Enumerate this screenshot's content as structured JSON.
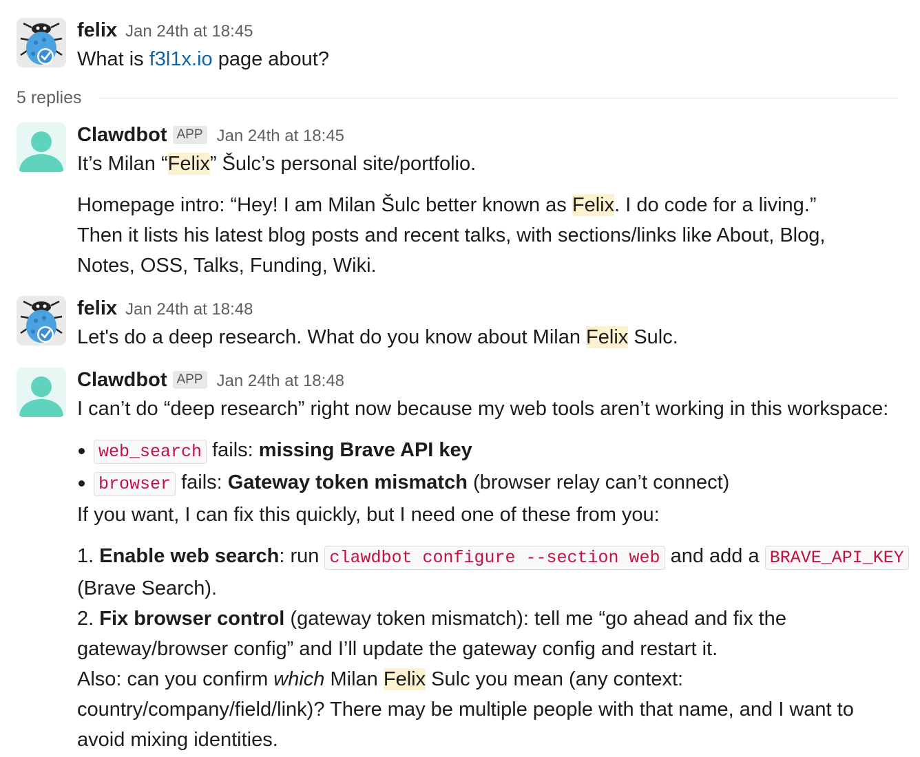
{
  "messages": [
    {
      "author": "felix",
      "time": "Jan 24th at 18:45",
      "avatar_icon": "bug-checkmark-icon",
      "text_before": "What is ",
      "link": "f3l1x.io",
      "text_after": " page about?"
    },
    {
      "author": "Clawdbot",
      "badge": "APP",
      "time": "Jan 24th at 18:45",
      "avatar_icon": "default-person-icon",
      "p1_a": "It’s Milan “",
      "p1_hl": "Felix",
      "p1_b": "” Šulc’s personal site/portfolio.",
      "p2_a": "Homepage intro: “Hey! I am Milan Šulc better known as ",
      "p2_hl": "Felix",
      "p2_b": ". I do code for a living.”",
      "p3": "Then it lists his latest blog posts and recent talks, with sections/links like About, Blog,",
      "p4": "Notes, OSS, Talks, Funding, Wiki."
    },
    {
      "author": "felix",
      "time": "Jan 24th at 18:48",
      "avatar_icon": "bug-checkmark-icon",
      "text_before": "Let's do a deep research. What do you know about Milan ",
      "hl": "Felix",
      "text_after": " Sulc."
    },
    {
      "author": "Clawdbot",
      "badge": "APP",
      "time": "Jan 24th at 18:48",
      "avatar_icon": "default-person-icon",
      "intro": "I can’t do “deep research” right now because my web tools aren’t working in this workspace:",
      "bullets": [
        {
          "code": "web_search",
          "text": " fails: ",
          "bold": "missing Brave API key",
          "rest": ""
        },
        {
          "code": "browser",
          "text": " fails: ",
          "bold": "Gateway token mismatch",
          "rest": " (browser relay can’t connect)"
        }
      ],
      "fix_intro": "If you want, I can fix this quickly, but I need one of these from you:",
      "item1_num": "1. ",
      "item1_bold": "Enable web search",
      "item1_a": ": run ",
      "item1_code1": "clawdbot configure --section web",
      "item1_b": " and add a ",
      "item1_code2": "BRAVE_API_KEY",
      "item1_c": "(Brave Search).",
      "item2_num": "2. ",
      "item2_bold": "Fix browser control",
      "item2_a": " (gateway token mismatch): tell me “go ahead and fix the",
      "item2_b": "gateway/browser config” and I’ll update the gateway config and restart it.",
      "also_a": "Also: can you confirm ",
      "also_em": "which",
      "also_b": " Milan ",
      "also_hl": "Felix",
      "also_c": " Sulc you mean (any context:",
      "also_d": "country/company/field/link)? There may be multiple people with that name, and I want to",
      "also_e": "avoid mixing identities."
    }
  ],
  "thread": {
    "replies_label": "5 replies"
  },
  "colors": {
    "link": "#1264a3",
    "highlight": "#fdf2d0",
    "code_text": "#c01343",
    "bot_avatar": "#5fd3be"
  }
}
